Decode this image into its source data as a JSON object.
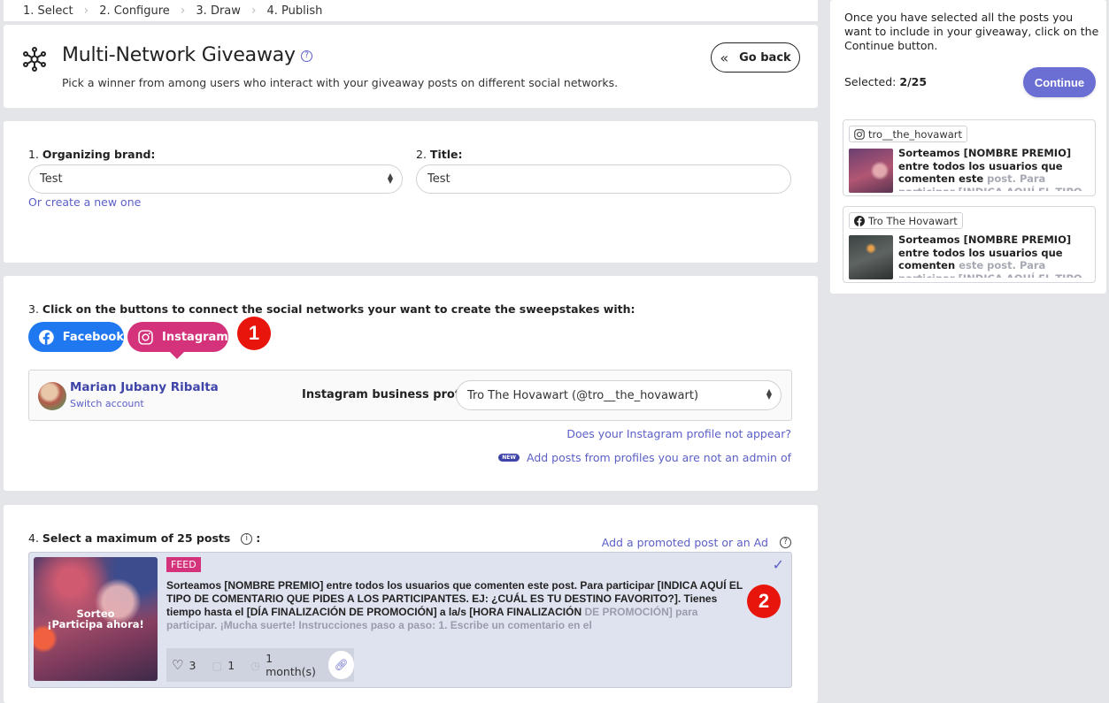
{
  "steps": [
    "1. Select",
    "2. Configure",
    "3. Draw",
    "4. Publish"
  ],
  "header": {
    "title": "Multi-Network Giveaway",
    "help_icon": "question-circle-icon",
    "subtitle": "Pick a winner from among users who interact with your giveaway posts on different social networks.",
    "go_back_label": "Go back"
  },
  "config": {
    "brand_num": "1.",
    "brand_label": "Organizing brand:",
    "brand_value": "Test",
    "create_new_link": "Or create a new one",
    "title_num": "2.",
    "title_label": "Title:",
    "title_value": "Test"
  },
  "networks": {
    "instruction_num": "3.",
    "instruction": "Click on the buttons to connect the social networks your want to create the sweepstakes with:",
    "buttons": [
      {
        "label": "Facebook",
        "icon": "facebook-icon",
        "color": "#1f78f0"
      },
      {
        "label": "Instagram",
        "icon": "instagram-icon",
        "color": "#d4327a",
        "active": true
      }
    ],
    "marker_1": "1",
    "account": {
      "name": "Marian Jubany Ribalta",
      "switch_label": "Switch account",
      "profile_label": "Instagram business profile:",
      "profile_value": "Tro The Hovawart (@tro__the_hovawart)"
    },
    "profile_missing_link": "Does your Instagram profile not appear?",
    "new_badge": "NEW",
    "add_posts_link": "Add posts from profiles you are not an admin of"
  },
  "posts": {
    "heading_num": "4.",
    "heading": "Select a maximum of 25 posts",
    "promoted_link": "Add a promoted post or an Ad",
    "marker_2": "2",
    "items": [
      {
        "type_badge": "FEED",
        "thumb_line1": "Sorteo",
        "thumb_line2": "¡Participa ahora!",
        "text_main": "Sorteamos [NOMBRE PREMIO] entre todos los usuarios que comenten este post. Para participar [INDICA AQUÍ EL TIPO DE COMENTARIO QUE PIDES A LOS PARTICIPANTES. EJ: ¿CUÁL ES TU DESTINO FAVORITO?]. Tienes tiempo hasta el [DÍA FINALIZACIÓN DE PROMOCIÓN] a la/s [HORA FINALIZACIÓN ",
        "text_fade": "DE PROMOCIÓN] para participar. ¡Mucha suerte! Instrucciones paso a paso: 1. Escribe un comentario en el",
        "likes": "3",
        "comments": "1",
        "age": "1 month(s)",
        "selected": true
      }
    ]
  },
  "sidebar": {
    "info": "Once you have selected all the posts you want to include in your giveaway, click on the Continue button.",
    "selected_label": "Selected:",
    "selected_value": "2/25",
    "continue_label": "Continue",
    "accent": "#6b6fd4",
    "selected_posts": [
      {
        "network_icon": "instagram-icon",
        "account": "tro__the_hovawart",
        "text_main": "Sorteamos [NOMBRE PREMIO] entre todos los usuarios que comenten este ",
        "text_fade": "post. Para participar [INDICA AQUÍ EL TIPO DE COMENTARIO QUE PIDES A"
      },
      {
        "network_icon": "facebook-icon",
        "account": "Tro The Hovawart",
        "text_main": "Sorteamos [NOMBRE PREMIO] entre todos los usuarios que comenten ",
        "text_fade": "este post. Para participar [INDICA AQUÍ EL TIPO DE COMENTARIO"
      }
    ]
  }
}
